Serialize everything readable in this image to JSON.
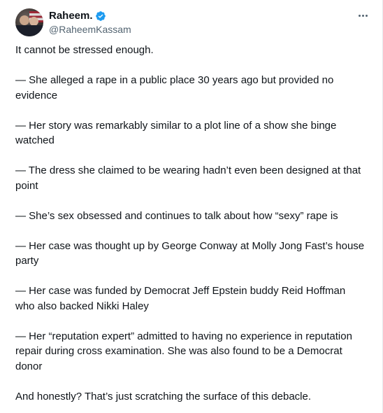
{
  "author": {
    "display_name": "Raheem.",
    "handle": "@RaheemKassam",
    "avatar_icon": "profile-photo",
    "verified_icon": "verified-badge-icon",
    "verified_color": "#1d9bf0"
  },
  "menu": {
    "icon": "more-horizontal-icon"
  },
  "tweet": {
    "paragraphs": [
      "It cannot be stressed enough.",
      "— She alleged a rape in a public place 30 years ago but provided no evidence",
      "— Her story was remarkably similar to a plot line of a show she binge watched",
      "— The dress she claimed to be wearing hadn’t even been designed at that point",
      "— She’s sex obsessed and continues to talk about how “sexy” rape is",
      "— Her case was thought up by George Conway at Molly Jong Fast’s house party",
      "— Her case was funded by Democrat Jeff Epstein buddy Reid Hoffman who also backed Nikki Haley",
      "— Her “reputation expert” admitted to having no experience in reputation repair during cross examination. She was also found to be a Democrat donor",
      "And honestly? That’s just scratching the surface of this debacle."
    ]
  }
}
